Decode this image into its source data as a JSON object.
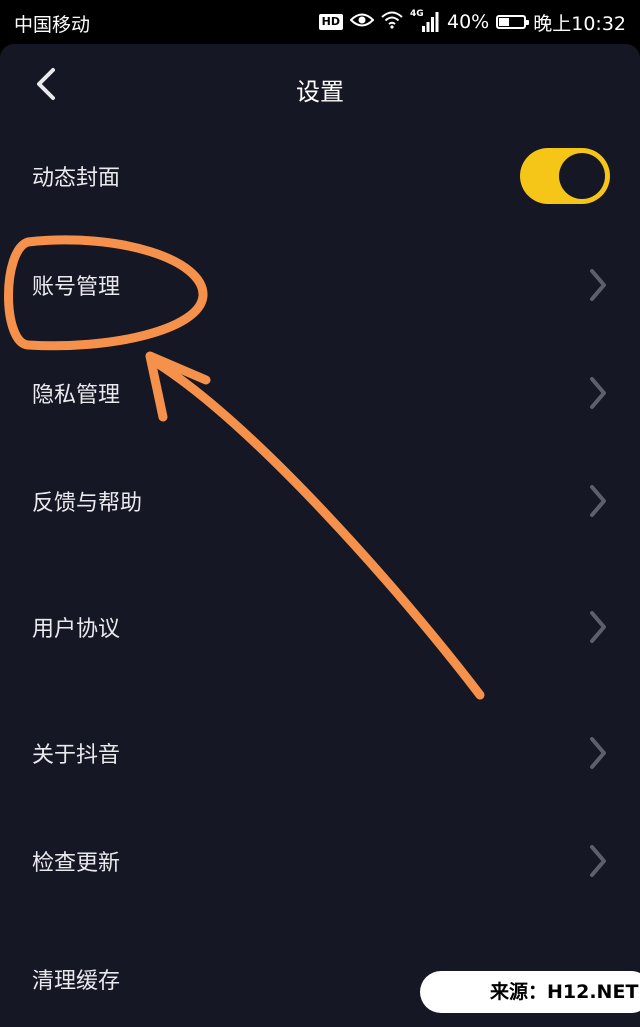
{
  "status_bar": {
    "carrier": "中国移动",
    "hd_badge": "HD",
    "network_type": "4G",
    "battery_percent_text": "40%",
    "battery_level": 0.4,
    "time": "晚上10:32",
    "icons": [
      "hd-icon",
      "eye-icon",
      "wifi-icon",
      "signal-4g-icon",
      "battery-icon"
    ]
  },
  "header": {
    "title": "设置",
    "back_icon": "chevron-left-icon"
  },
  "settings": {
    "items": [
      {
        "label": "动态封面",
        "control": "toggle",
        "toggle_on": true
      },
      {
        "label": "账号管理",
        "control": "chevron"
      },
      {
        "label": "隐私管理",
        "control": "chevron"
      },
      {
        "label": "反馈与帮助",
        "control": "chevron"
      },
      {
        "label": "用户协议",
        "control": "chevron"
      },
      {
        "label": "关于抖音",
        "control": "chevron"
      },
      {
        "label": "检查更新",
        "control": "chevron"
      },
      {
        "label": "清理缓存",
        "control": "none"
      }
    ]
  },
  "watermark": {
    "text": "来源：H12.NET"
  },
  "colors": {
    "background": "#161724",
    "toggle_on": "#f5c518",
    "chevron": "#5e5f6b",
    "annotation": "#f5914a"
  }
}
